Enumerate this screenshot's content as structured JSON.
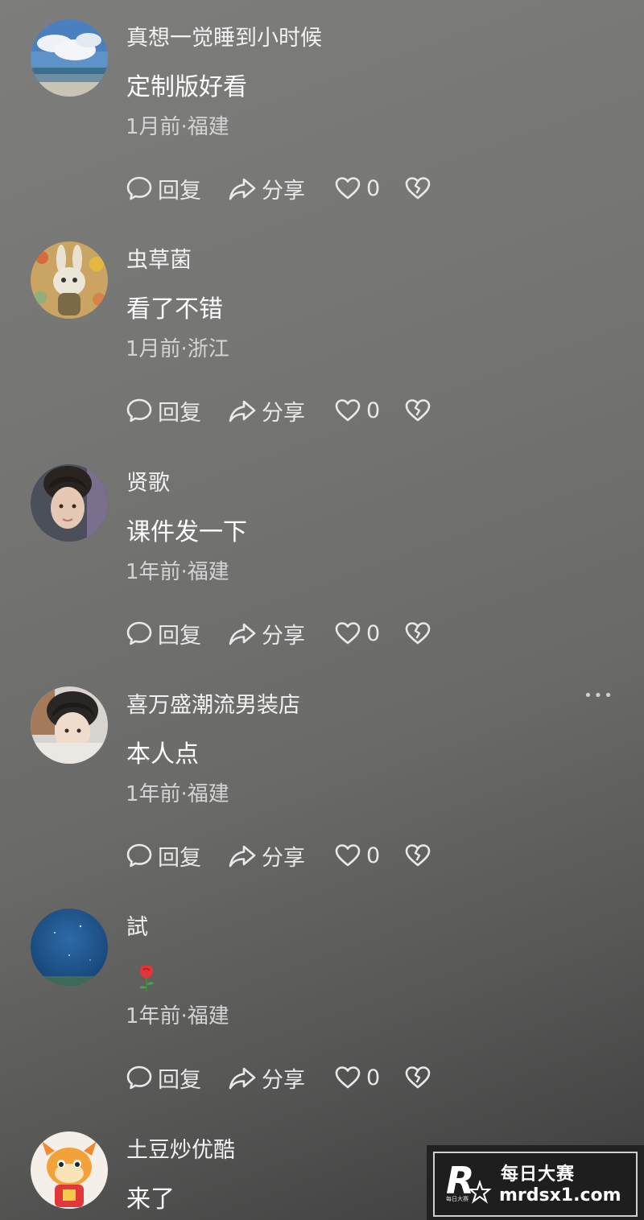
{
  "comments": [
    {
      "username": "真想一觉睡到小时候",
      "content": "定制版好看",
      "meta": "1月前·福建",
      "reply_label": "回复",
      "share_label": "分享",
      "likes": "0",
      "avatar": "sky-beach-avatar"
    },
    {
      "username": "虫草菌",
      "content": "看了不错",
      "meta": "1月前·浙江",
      "reply_label": "回复",
      "share_label": "分享",
      "likes": "0",
      "avatar": "rabbit-avatar"
    },
    {
      "username": "贤歌",
      "content": "课件发一下",
      "meta": "1年前·福建",
      "reply_label": "回复",
      "share_label": "分享",
      "likes": "0",
      "avatar": "portrait-avatar"
    },
    {
      "username": "喜万盛潮流男装店",
      "content": "本人点",
      "meta": "1年前·福建",
      "reply_label": "回复",
      "share_label": "分享",
      "likes": "0",
      "avatar": "portrait-avatar",
      "more": "•••"
    },
    {
      "username": "試",
      "content": "",
      "meta": "1年前·福建",
      "reply_label": "回复",
      "share_label": "分享",
      "likes": "0",
      "avatar": "starry-sky-avatar",
      "emoji": "rose-emoji"
    },
    {
      "username": "土豆炒优酷",
      "content": "来了",
      "avatar": "dragon-avatar"
    }
  ],
  "watermark": {
    "title": "每日大赛",
    "url": "mrdsx1.com",
    "small": "每日大赛"
  },
  "colors": {
    "text_primary": "#ffffff",
    "text_secondary": "#d4d4d4",
    "background_top": "#7d7d7b",
    "background_bottom": "#3c3c3c"
  }
}
